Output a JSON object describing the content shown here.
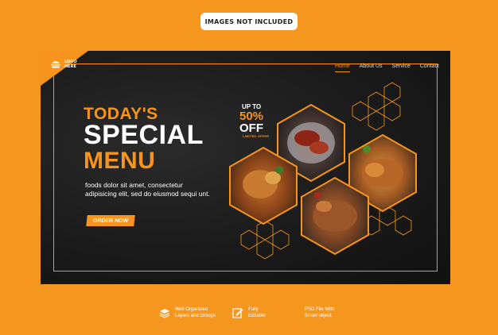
{
  "badge": {
    "label": "IMAGES NOT INCLUDED"
  },
  "logo": {
    "text": "LOGO HERE"
  },
  "nav": {
    "items": [
      {
        "label": "Home",
        "active": true
      },
      {
        "label": "About Us",
        "active": false
      },
      {
        "label": "Service",
        "active": false
      },
      {
        "label": "Contact",
        "active": false
      }
    ]
  },
  "hero": {
    "line1": "TODAY'S",
    "line2": "SPECIAL",
    "line3": "MENU",
    "description": "foods dolor sit amet, consectetur adipisicing elit, sed do eiusmod sequi unt.",
    "cta_label": "ORDER NOW"
  },
  "promo": {
    "upto": "UP TO",
    "percent": "50%",
    "off": "OFF",
    "limited": "LIMITED OFFER"
  },
  "footer": {
    "features": [
      {
        "icon": "layers-icon",
        "line1": "Well Organized",
        "line2": "Layers and Groups"
      },
      {
        "icon": "edit-icon",
        "line1": "Fully",
        "line2": "Editable"
      },
      {
        "icon": "",
        "line1": "PSD File With",
        "line2": "Smart object"
      }
    ]
  },
  "colors": {
    "background": "#f5961f",
    "accent": "#f7941d",
    "panel": "#1a1a1a",
    "text": "#ffffff"
  }
}
